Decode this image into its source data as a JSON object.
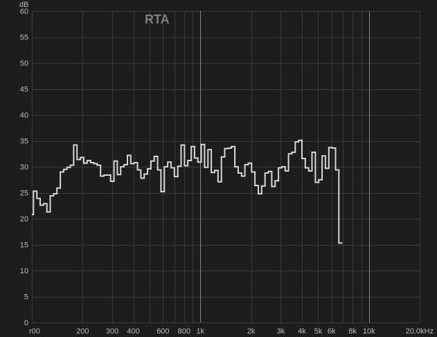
{
  "chart_data": {
    "type": "line",
    "title": "RTA",
    "ylabel": "dB",
    "xlabel": "",
    "x_scale": "log",
    "xlim": [
      100,
      20000
    ],
    "ylim": [
      0,
      60
    ],
    "grid": true,
    "y_ticks": [
      0,
      5,
      10,
      15,
      20,
      25,
      30,
      35,
      40,
      45,
      50,
      55,
      60
    ],
    "x_tick_labels": [
      {
        "f": 100,
        "label": "r00"
      },
      {
        "f": 200,
        "label": "200"
      },
      {
        "f": 300,
        "label": "300"
      },
      {
        "f": 400,
        "label": "400"
      },
      {
        "f": 600,
        "label": "600"
      },
      {
        "f": 800,
        "label": "800"
      },
      {
        "f": 1000,
        "label": "1k"
      },
      {
        "f": 2000,
        "label": "2k"
      },
      {
        "f": 3000,
        "label": "3k"
      },
      {
        "f": 4000,
        "label": "4k"
      },
      {
        "f": 5000,
        "label": "5k"
      },
      {
        "f": 6000,
        "label": "6k"
      },
      {
        "f": 8000,
        "label": "8k"
      },
      {
        "f": 10000,
        "label": "10k"
      },
      {
        "f": 20000,
        "label": "20.0kHz"
      }
    ],
    "minor_grid_freqs": [
      100,
      200,
      300,
      400,
      500,
      600,
      700,
      800,
      900,
      1000,
      2000,
      3000,
      4000,
      5000,
      6000,
      7000,
      8000,
      9000,
      10000,
      20000
    ],
    "major_grid_freqs": [
      1000,
      10000
    ],
    "series": [
      {
        "color": "#d8d8d8",
        "band_edges": [
          100,
          102.2,
          107.0,
          112.0,
          117.3,
          122.8,
          128.5,
          134.6,
          140.9,
          147.5,
          154.4,
          161.6,
          169.2,
          177.1,
          185.4,
          194.1,
          203.2,
          212.8,
          222.8,
          233.2,
          244.1,
          255.6,
          267.6,
          280.2,
          293.3,
          307.1,
          321.5,
          336.6,
          352.4,
          368.9,
          386.2,
          404.3,
          423.3,
          443.2,
          463.9,
          485.7,
          508.5,
          532.4,
          557.3,
          583.5,
          610.9,
          639.5,
          669.6,
          701.0,
          733.9,
          768.3,
          804.4,
          842.1,
          881.6,
          923.0,
          966.3,
          1011.6,
          1059.1,
          1108.8,
          1160.8,
          1215.3,
          1272.3,
          1332.0,
          1394.5,
          1460.0,
          1528.5,
          1600.2,
          1675.3,
          1753.9,
          1836.2,
          1922.4,
          2012.6,
          2107.1,
          2205.9,
          2309.5,
          2417.8,
          2531.3,
          2650.1,
          2774.4,
          2904.6,
          3040.9,
          3183.6,
          3333.0,
          3489.4,
          3653.1,
          3824.6,
          4004.0,
          4191.9,
          4388.6,
          4594.6,
          4810.2,
          5035.9,
          5272.2,
          5519.7,
          5778.7,
          6049.9,
          6333.8,
          6631.0,
          6942.2,
          7268.0,
          7609.0,
          7966.1,
          8339.9,
          8731.3,
          9141.0,
          9570.0,
          10019.1,
          10489.2,
          10981.5,
          11496.8,
          12036.3,
          12601.1,
          13192.5,
          13811.6,
          14459.7,
          15138.3,
          15848.6,
          16592.4,
          17371.0,
          18186.2,
          19039.6,
          19933.1,
          20000
        ],
        "values": [
          20.8,
          25.3,
          23.9,
          22.6,
          22.9,
          21.3,
          24.4,
          24.8,
          25.9,
          29.0,
          29.5,
          29.9,
          30.3,
          34.2,
          31.4,
          31.8,
          30.7,
          31.2,
          30.8,
          30.6,
          30.3,
          28.2,
          28.4,
          28.4,
          27.2,
          31.1,
          28.5,
          30.0,
          30.4,
          32.2,
          30.6,
          30.8,
          29.4,
          27.8,
          28.6,
          29.6,
          31.1,
          32.0,
          29.4,
          25.2,
          30.0,
          30.9,
          29.8,
          28.1,
          30.1,
          34.2,
          30.2,
          31.2,
          33.9,
          31.7,
          30.9,
          34.3,
          29.9,
          33.3,
          28.9,
          29.3,
          27.1,
          31.9,
          33.5,
          33.6,
          33.9,
          30.0,
          28.8,
          28.2,
          30.4,
          30.7,
          29.0,
          26.4,
          24.8,
          26.3,
          28.8,
          29.1,
          26.2,
          27.3,
          29.8,
          30.0,
          29.2,
          32.5,
          32.8,
          34.8,
          35.1,
          31.6,
          29.8,
          29.2,
          32.8,
          27.0,
          27.5,
          32.1,
          29.7,
          33.7,
          33.6,
          29.4,
          15.3
        ]
      }
    ]
  }
}
